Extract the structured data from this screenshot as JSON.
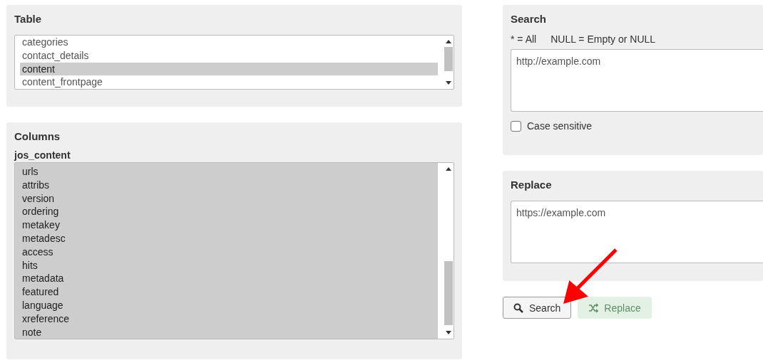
{
  "table_panel": {
    "title": "Table",
    "items": [
      {
        "label": "categories",
        "selected": false
      },
      {
        "label": "contact_details",
        "selected": false
      },
      {
        "label": "content",
        "selected": true
      },
      {
        "label": "content_frontpage",
        "selected": false
      }
    ]
  },
  "columns_panel": {
    "title": "Columns",
    "table_name": "jos_content",
    "items": [
      {
        "label": "urls",
        "selected": true
      },
      {
        "label": "attribs",
        "selected": true
      },
      {
        "label": "version",
        "selected": true
      },
      {
        "label": "ordering",
        "selected": true
      },
      {
        "label": "metakey",
        "selected": true
      },
      {
        "label": "metadesc",
        "selected": true
      },
      {
        "label": "access",
        "selected": true
      },
      {
        "label": "hits",
        "selected": true
      },
      {
        "label": "metadata",
        "selected": true
      },
      {
        "label": "featured",
        "selected": true
      },
      {
        "label": "language",
        "selected": true
      },
      {
        "label": "xreference",
        "selected": true
      },
      {
        "label": "note",
        "selected": true
      }
    ]
  },
  "search_panel": {
    "title": "Search",
    "hints": [
      "* = All",
      "NULL = Empty or NULL"
    ],
    "value": "http://example.com",
    "case_sensitive": {
      "label": "Case sensitive",
      "checked": false
    }
  },
  "replace_panel": {
    "title": "Replace",
    "value": "https://example.com"
  },
  "buttons": [
    {
      "kind": "search",
      "label": "Search",
      "disabled": false
    },
    {
      "kind": "replace",
      "label": "Replace",
      "disabled": true
    }
  ]
}
